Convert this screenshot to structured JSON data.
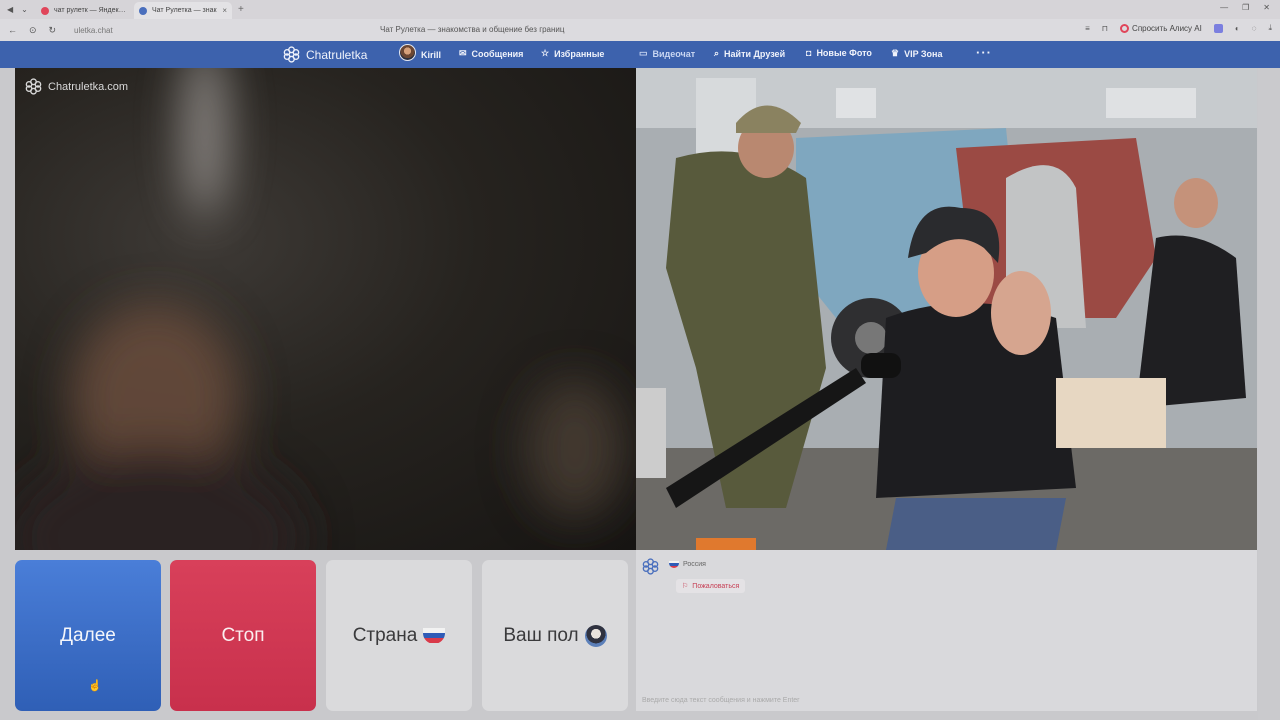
{
  "browser": {
    "tabs": [
      {
        "label": "чат рулетк — Яндекс: наш",
        "color": "#e0455a"
      },
      {
        "label": "Чат Рулетка — знак",
        "color": "#4a6fbd"
      }
    ],
    "url": "uletka.chat",
    "page_title": "Чат Рулетка — знакомства и общение без границ",
    "alice_label": "Спросить Алису AI"
  },
  "nav": {
    "brand": "Chatruletka",
    "user": "Kirill",
    "messages": "Сообщения",
    "favorites": "Избранные",
    "videochat": "Видеочат",
    "find_friends": "Найти Друзей",
    "new_photos": "Новые Фото",
    "vip": "VIP Зона",
    "more": "···"
  },
  "video": {
    "watermark": "Chatruletka.com"
  },
  "controls": {
    "next": "Далее",
    "stop": "Стоп",
    "country": "Страна",
    "gender": "Ваш пол"
  },
  "chat": {
    "country": "Россия",
    "report": "Пожаловаться",
    "input_placeholder": "Введите сюда текст сообщения и нажмите Enter"
  },
  "colors": {
    "nav_bg": "#3d62ad",
    "next_bg": "#3a6cc7",
    "stop_bg": "#d0384f"
  },
  "icons": [
    "chatruletka-logo-icon",
    "envelope-icon",
    "star-icon",
    "video-icon",
    "search-icon",
    "camera-icon",
    "crown-icon",
    "flag-icon",
    "russia-flag-icon",
    "gender-icon"
  ]
}
